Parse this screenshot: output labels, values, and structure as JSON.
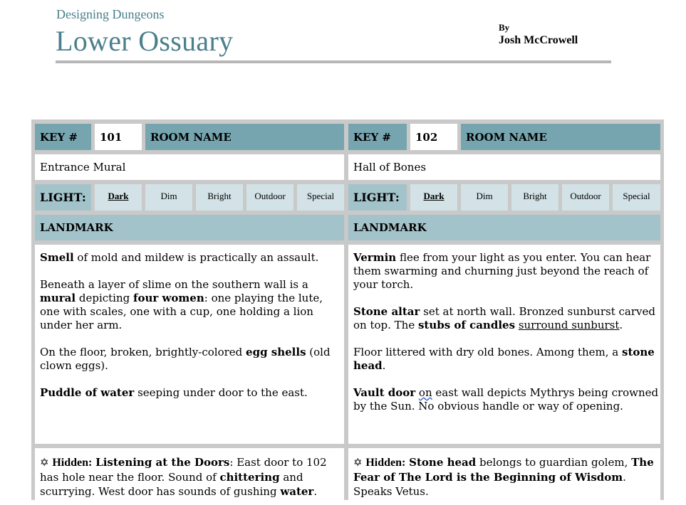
{
  "header": {
    "subtitle": "Designing Dungeons",
    "title": "Lower Ossuary",
    "by_label": "By",
    "author": "Josh McCrowell"
  },
  "labels": {
    "key": "KEY #",
    "room_name": "ROOM NAME",
    "light": "LIGHT:",
    "landmark": "LANDMARK",
    "hidden": "Hidden:"
  },
  "light_options": [
    "Dark",
    "Dim",
    "Bright",
    "Outdoor",
    "Special"
  ],
  "icons": {
    "hidden_marker": "clover-icon"
  },
  "colors": {
    "accent": "#4a7f8c",
    "header_cell": "#76a5b0",
    "landmark_cell": "#a3c3ca",
    "light_option_cell": "#d2e2e6",
    "grid_border": "#c9c9c9"
  },
  "rooms": [
    {
      "key": "101",
      "name": "Entrance Mural",
      "light_selected": "Dark",
      "description": [
        [
          "Smell",
          " of mold and mildew is practically an assault."
        ],
        [
          "Beneath a layer of slime on the southern wall is a ",
          "mural",
          " depicting ",
          "four women",
          ": one playing the lute, one with scales, one with a cup, one holding a lion under her arm."
        ],
        [
          "On the floor, broken, brightly-colored ",
          "egg shells",
          " (old clown eggs)."
        ],
        [
          "Puddle of water",
          " seeping under door to the east."
        ]
      ],
      "hidden": {
        "heading": "Listening at the Doors",
        "parts": [
          ": East door to 102 has hole near the floor. Sound of ",
          "chittering",
          " and scurrying. West door has sounds of gushing ",
          "water",
          "."
        ]
      }
    },
    {
      "key": "102",
      "name": "Hall of Bones",
      "light_selected": "Dark",
      "description": [
        [
          "Vermin",
          " flee from your light as you enter. You can hear them swarming and churning just beyond the reach of your torch."
        ],
        [
          "Stone altar",
          " set at north wall. Bronzed sunburst carved on top. The ",
          "stubs of candles",
          " ",
          "surround sunburst",
          "."
        ],
        [
          "Floor littered with dry old bones. Among them, a ",
          "stone head",
          "."
        ],
        [
          "Vault door",
          " ",
          "on",
          " east wall depicts Mythrys being crowned by the Sun. No obvious handle or way of opening."
        ]
      ],
      "hidden": {
        "heading": "Stone head",
        "parts": [
          " belongs to guardian golem, ",
          "The Fear of The Lord is the Beginning of Wisdom",
          ". Speaks Vetus."
        ]
      }
    }
  ]
}
